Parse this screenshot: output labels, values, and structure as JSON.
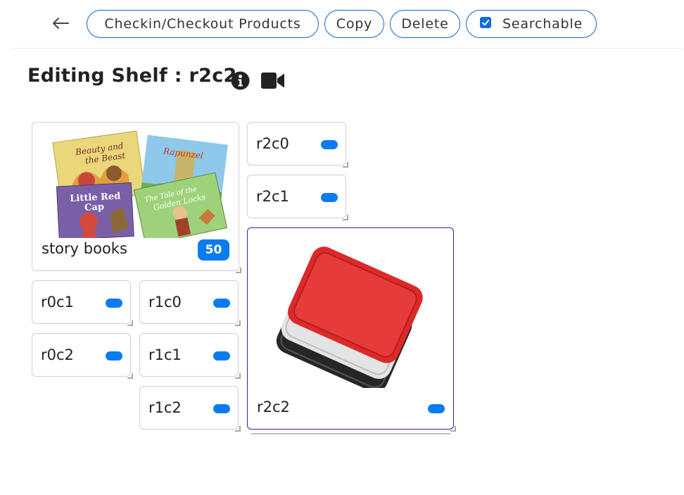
{
  "toolbar": {
    "back_icon": "arrow-left-icon",
    "checkin_label": "Checkin/Checkout Products",
    "copy_label": "Copy",
    "delete_label": "Delete",
    "searchable_label": "Searchable",
    "searchable_checked": true
  },
  "header": {
    "title": "Editing Shelf : r2c2",
    "info_icon": "info-circle-icon",
    "video_icon": "video-camera-icon"
  },
  "cells": {
    "story": {
      "label": "story books",
      "count": "50",
      "image": "story-books-image"
    },
    "r0c1": {
      "label": "r0c1"
    },
    "r0c2": {
      "label": "r0c2"
    },
    "r1c0": {
      "label": "r1c0"
    },
    "r1c1": {
      "label": "r1c1"
    },
    "r1c2": {
      "label": "r1c2"
    },
    "r2c0": {
      "label": "r2c0"
    },
    "r2c1": {
      "label": "r2c1"
    },
    "r2c2": {
      "label": "r2c2",
      "image": "serving-trays-image",
      "selected": true
    }
  },
  "colors": {
    "accent": "#0b7bf0",
    "pill_border": "#1565c0",
    "selected_border": "#2424b8"
  }
}
